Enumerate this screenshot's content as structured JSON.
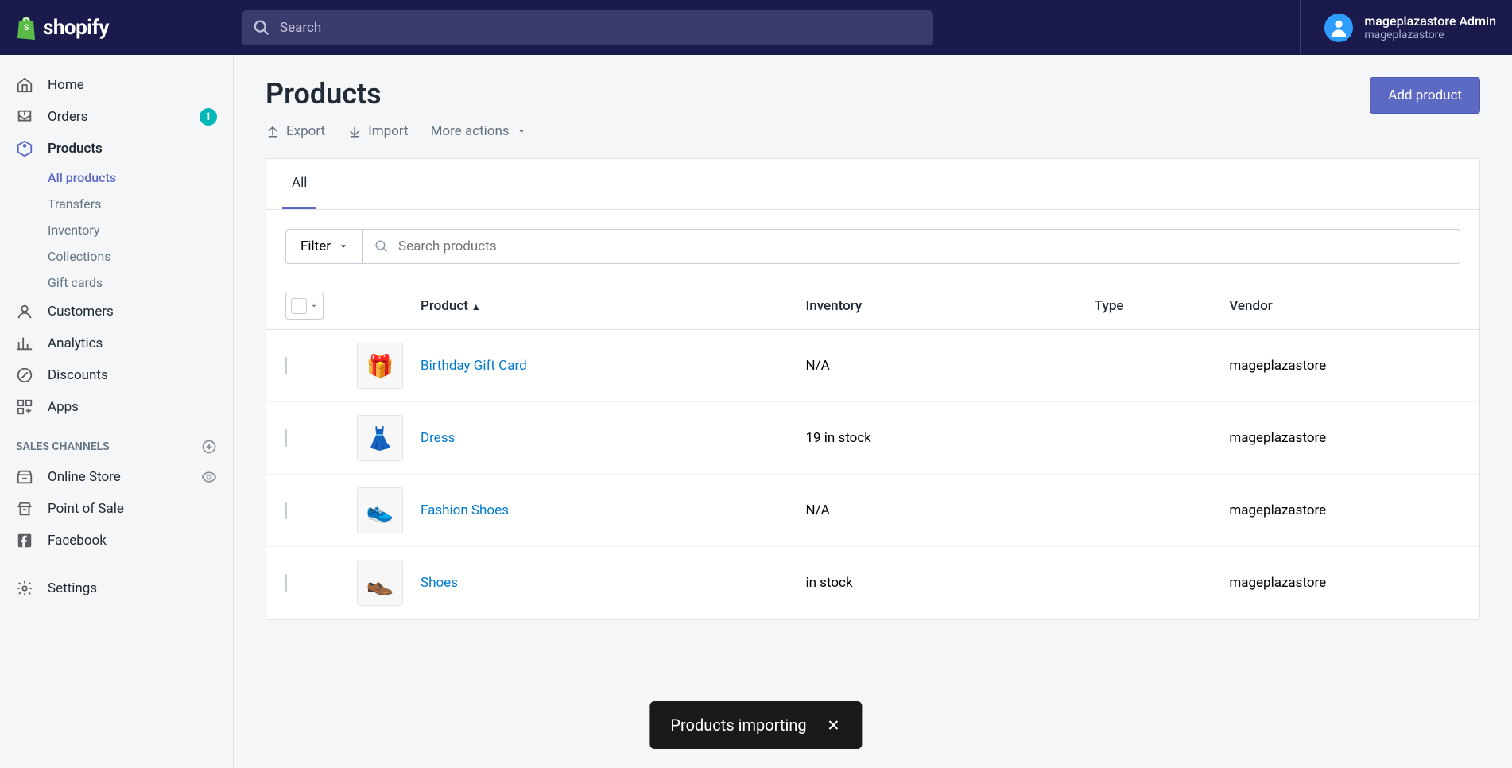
{
  "brand": "shopify",
  "search": {
    "placeholder": "Search"
  },
  "user": {
    "name": "mageplazastore Admin",
    "store": "mageplazastore"
  },
  "sidebar": {
    "items": [
      {
        "label": "Home"
      },
      {
        "label": "Orders",
        "badge": "1"
      },
      {
        "label": "Products"
      },
      {
        "label": "Customers"
      },
      {
        "label": "Analytics"
      },
      {
        "label": "Discounts"
      },
      {
        "label": "Apps"
      }
    ],
    "sub_products": [
      {
        "label": "All products"
      },
      {
        "label": "Transfers"
      },
      {
        "label": "Inventory"
      },
      {
        "label": "Collections"
      },
      {
        "label": "Gift cards"
      }
    ],
    "sales_channels_label": "SALES CHANNELS",
    "channels": [
      {
        "label": "Online Store"
      },
      {
        "label": "Point of Sale"
      },
      {
        "label": "Facebook"
      }
    ],
    "settings_label": "Settings"
  },
  "page": {
    "title": "Products",
    "export": "Export",
    "import": "Import",
    "more_actions": "More actions",
    "add_product": "Add product"
  },
  "tabs": {
    "all": "All"
  },
  "filter": {
    "label": "Filter",
    "search_placeholder": "Search products"
  },
  "columns": {
    "product": "Product",
    "inventory": "Inventory",
    "type": "Type",
    "vendor": "Vendor"
  },
  "products": [
    {
      "name": "Birthday Gift Card",
      "inventory": "N/A",
      "type": "",
      "vendor": "mageplazastore",
      "thumb": "🎁"
    },
    {
      "name": "Dress",
      "inventory": "19 in stock",
      "type": "",
      "vendor": "mageplazastore",
      "thumb": "👗"
    },
    {
      "name": "Fashion Shoes",
      "inventory": "N/A",
      "type": "",
      "vendor": "mageplazastore",
      "thumb": "👟"
    },
    {
      "name": "Shoes",
      "inventory": "in stock",
      "type": "",
      "vendor": "mageplazastore",
      "thumb": "👞"
    }
  ],
  "toast": {
    "message": "Products importing"
  }
}
